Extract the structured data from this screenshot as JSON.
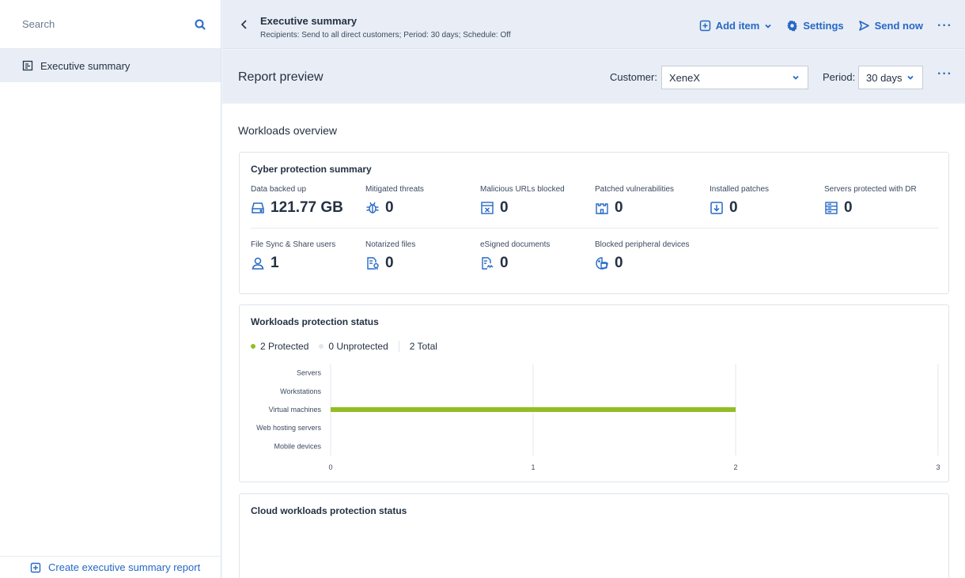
{
  "sidebar": {
    "search_placeholder": "Search",
    "items": [
      {
        "label": "Executive summary"
      }
    ],
    "footer_label": "Create executive summary report"
  },
  "header": {
    "title": "Executive summary",
    "subtitle": "Recipients: Send to all direct customers;  Period: 30 days;  Schedule: Off",
    "actions": {
      "add_item": "Add item",
      "settings": "Settings",
      "send_now": "Send now",
      "more": "···"
    }
  },
  "toolbar": {
    "title": "Report preview",
    "customer_label": "Customer:",
    "customer_value": "XeneX",
    "period_label": "Period:",
    "period_value": "30 days",
    "more": "···"
  },
  "content": {
    "section_title": "Workloads overview",
    "cyber": {
      "title": "Cyber protection summary",
      "metrics": [
        {
          "label": "Data backed up",
          "value": "121.77 GB",
          "icon": "drive-icon"
        },
        {
          "label": "Mitigated threats",
          "value": "0",
          "icon": "bug-icon"
        },
        {
          "label": "Malicious URLs blocked",
          "value": "0",
          "icon": "blocked-url-icon"
        },
        {
          "label": "Patched vulnerabilities",
          "value": "0",
          "icon": "castle-icon"
        },
        {
          "label": "Installed patches",
          "value": "0",
          "icon": "download-icon"
        },
        {
          "label": "Servers protected with DR",
          "value": "0",
          "icon": "server-icon"
        },
        {
          "label": "File Sync & Share users",
          "value": "1",
          "icon": "user-icon"
        },
        {
          "label": "Notarized files",
          "value": "0",
          "icon": "notarized-file-icon"
        },
        {
          "label": "eSigned documents",
          "value": "0",
          "icon": "signed-document-icon"
        },
        {
          "label": "Blocked peripheral devices",
          "value": "0",
          "icon": "peripheral-icon"
        }
      ]
    },
    "workloads": {
      "title": "Workloads protection status",
      "legend": [
        {
          "label": "2 Protected",
          "color": "#93bd25"
        },
        {
          "label": "0 Unprotected",
          "color": "#e3e6eb"
        }
      ],
      "total": "2 Total"
    },
    "cloud": {
      "title": "Cloud workloads protection status"
    }
  },
  "chart_data": {
    "type": "bar",
    "orientation": "horizontal",
    "categories": [
      "Servers",
      "Workstations",
      "Virtual machines",
      "Web hosting servers",
      "Mobile devices"
    ],
    "series": [
      {
        "name": "Protected",
        "values": [
          0,
          0,
          2,
          0,
          0
        ],
        "color": "#93bd25"
      }
    ],
    "xlim": [
      0,
      3
    ],
    "xticks": [
      0,
      1,
      2,
      3
    ],
    "grid": true
  }
}
